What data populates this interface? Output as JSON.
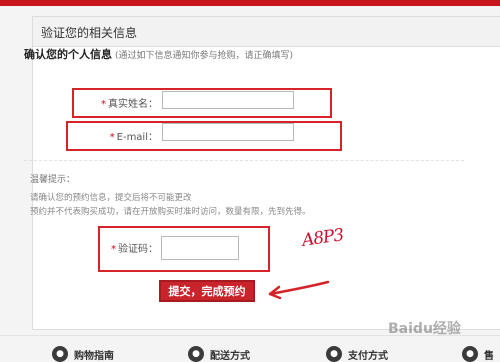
{
  "panel": {
    "title": "验证您的相关信息"
  },
  "section": {
    "title": "确认您的个人信息",
    "hint": "(通过如下信息通知你参与抢购，请正确填写)"
  },
  "form": {
    "required_mark": "*",
    "name_label": "真实姓名：",
    "name_value": "",
    "email_label": "E-mail：",
    "email_value": "",
    "captcha_label": "验证码：",
    "captcha_value": ""
  },
  "tips": {
    "title": "温馨提示：",
    "lines": [
      "请确认您的预约信息，提交后将不可能更改",
      "预约并不代表购买成功，请在开放购买时准时访问，数量有限，先到先得。"
    ]
  },
  "captcha_image_text": "A8P3",
  "submit_label": "提交，完成预约",
  "footer": {
    "items": [
      {
        "label": "购物指南"
      },
      {
        "label": "配送方式"
      },
      {
        "label": "支付方式"
      },
      {
        "label": "售"
      }
    ]
  },
  "watermark": "Baidu经验",
  "colors": {
    "accent": "#c8161d",
    "annotation": "#d6232a",
    "button": "#c9242b"
  }
}
